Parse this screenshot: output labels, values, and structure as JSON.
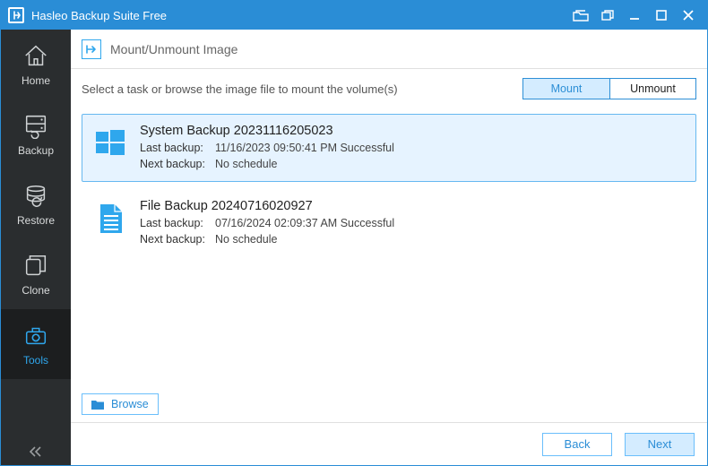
{
  "app": {
    "title": "Hasleo Backup Suite Free"
  },
  "sidebar": {
    "items": [
      {
        "label": "Home"
      },
      {
        "label": "Backup"
      },
      {
        "label": "Restore"
      },
      {
        "label": "Clone"
      },
      {
        "label": "Tools"
      }
    ]
  },
  "page": {
    "title": "Mount/Unmount Image",
    "prompt": "Select a task or browse the image file to mount the volume(s)",
    "segmented": {
      "mount": "Mount",
      "unmount": "Unmount",
      "active": "mount"
    },
    "labels": {
      "last_backup": "Last backup:",
      "next_backup": "Next backup:"
    },
    "browse": "Browse"
  },
  "tasks": [
    {
      "name": "System Backup 20231116205023",
      "last": "11/16/2023 09:50:41 PM Successful",
      "next": "No schedule",
      "icon": "windows",
      "selected": true
    },
    {
      "name": "File Backup 20240716020927",
      "last": "07/16/2024 02:09:37 AM Successful",
      "next": "No schedule",
      "icon": "file",
      "selected": false
    }
  ],
  "footer": {
    "back": "Back",
    "next": "Next"
  }
}
